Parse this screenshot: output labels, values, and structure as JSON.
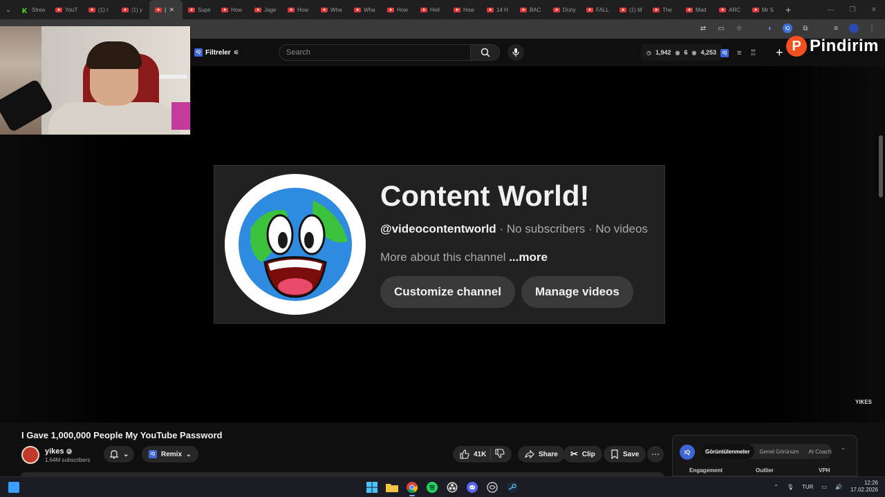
{
  "browser": {
    "tabs": [
      {
        "label": "Strea",
        "icon": "kick-icon"
      },
      {
        "label": "YouT",
        "icon": "youtube-icon"
      },
      {
        "label": "(1) I",
        "icon": "youtube-icon"
      },
      {
        "label": "(1) y",
        "icon": "youtube-icon"
      },
      {
        "label": "(",
        "icon": "youtube-icon",
        "active": true
      },
      {
        "label": "Supe",
        "icon": "youtube-icon"
      },
      {
        "label": "How",
        "icon": "youtube-icon"
      },
      {
        "label": "Jage",
        "icon": "youtube-icon"
      },
      {
        "label": "How",
        "icon": "youtube-icon"
      },
      {
        "label": "Wha",
        "icon": "youtube-icon"
      },
      {
        "label": "Wha",
        "icon": "youtube-icon"
      },
      {
        "label": "How",
        "icon": "youtube-icon"
      },
      {
        "label": "Hell",
        "icon": "youtube-icon"
      },
      {
        "label": "How",
        "icon": "youtube-icon"
      },
      {
        "label": "14 H",
        "icon": "youtube-icon"
      },
      {
        "label": "BAC",
        "icon": "youtube-icon"
      },
      {
        "label": "Düny",
        "icon": "youtube-icon"
      },
      {
        "label": "FALL",
        "icon": "youtube-icon"
      },
      {
        "label": "(1) M",
        "icon": "youtube-icon"
      },
      {
        "label": "The",
        "icon": "youtube-icon"
      },
      {
        "label": "Mad",
        "icon": "youtube-icon"
      },
      {
        "label": "ARC",
        "icon": "youtube-icon"
      },
      {
        "label": "Mr S",
        "icon": "youtube-icon"
      }
    ],
    "url_fragment": "s"
  },
  "youtube_header": {
    "filter_label": "Filtreler",
    "search_placeholder": "Search",
    "stats": {
      "views": "1,942",
      "watching": "6",
      "other": "4,253"
    }
  },
  "overlay_brand": {
    "logo_letter": "P",
    "name": "Pindirim"
  },
  "channel_card": {
    "title": "Content World!",
    "handle": "@videocontentworld",
    "subscribers": "No subscribers",
    "videos": "No videos",
    "about_text": "More about this channel",
    "more_link": "...more",
    "customize_button": "Customize channel",
    "manage_button": "Manage videos"
  },
  "player": {
    "watermark": "YIKES"
  },
  "video": {
    "title": "I Gave 1,000,000 People My YouTube Password",
    "channel_name": "yikes",
    "subscribers": "1.64M subscribers",
    "remix_label": "Remix",
    "likes": "41K",
    "share_label": "Share",
    "clip_label": "Clip",
    "save_label": "Save"
  },
  "iq_panel": {
    "tabs": [
      "Görüntülenmeler",
      "Genel Görünüm",
      "AI Coach"
    ],
    "columns": [
      "Engagement",
      "Outlier",
      "VPH"
    ]
  },
  "taskbar": {
    "apps": [
      "windows-start-icon",
      "file-explorer-icon",
      "chrome-icon",
      "spotify-icon",
      "obs-icon",
      "discord-icon",
      "app-icon",
      "steam-icon"
    ],
    "language": "TUR",
    "time": "12:26",
    "date": "17.02.2026"
  }
}
